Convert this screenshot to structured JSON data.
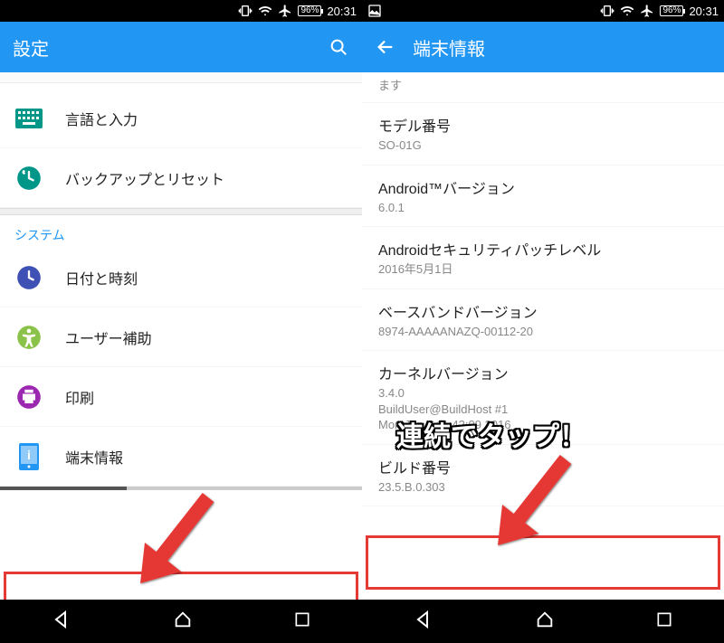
{
  "status": {
    "battery": "96%",
    "time": "20:31"
  },
  "left": {
    "app_title": "設定",
    "rows": {
      "lang_input": "言語と入力",
      "backup_reset": "バックアップとリセット",
      "system_header": "システム",
      "datetime": "日付と時刻",
      "accessibility": "ユーザー補助",
      "printing": "印刷",
      "about_phone": "端末情報"
    }
  },
  "right": {
    "app_title": "端末情報",
    "clipped_top": "ます",
    "model": {
      "title": "モデル番号",
      "value": "SO-01G"
    },
    "android_version": {
      "title": "Android™バージョン",
      "value": "6.0.1"
    },
    "security_patch": {
      "title": "Androidセキュリティパッチレベル",
      "value": "2016年5月1日"
    },
    "baseband": {
      "title": "ベースバンドバージョン",
      "value": "8974-AAAAANAZQ-00112-20"
    },
    "kernel": {
      "title": "カーネルバージョン",
      "sub1": "3.4.0",
      "sub2": "BuildUser@BuildHost #1",
      "sub3": "Mon Jun 6 11:42:09 2016"
    },
    "build": {
      "title": "ビルド番号",
      "value": "23.5.B.0.303"
    }
  },
  "callout": "連続でタップ！"
}
